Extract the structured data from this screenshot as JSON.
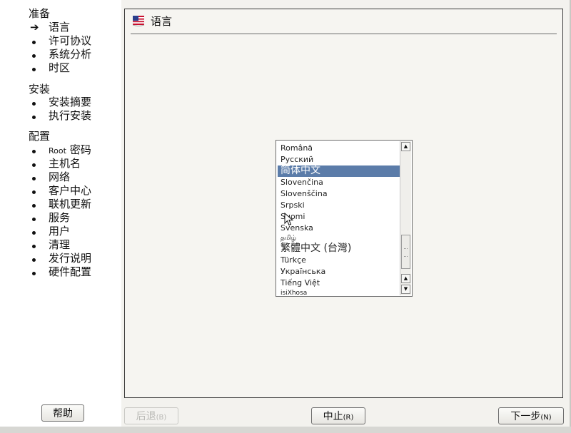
{
  "sidebar": {
    "sections": [
      {
        "title": "准备",
        "steps": [
          {
            "label": "语言",
            "marker": "arrow",
            "current": true
          },
          {
            "label": "许可协议",
            "marker": "bullet"
          },
          {
            "label": "系统分析",
            "marker": "bullet"
          },
          {
            "label": "时区",
            "marker": "bullet"
          }
        ]
      },
      {
        "title": "安装",
        "steps": [
          {
            "label": "安装摘要",
            "marker": "bullet"
          },
          {
            "label": "执行安装",
            "marker": "bullet"
          }
        ]
      },
      {
        "title": "配置",
        "steps": [
          {
            "label_small": "Root",
            "label": " 密码",
            "marker": "bullet"
          },
          {
            "label": "主机名",
            "marker": "bullet"
          },
          {
            "label": "网络",
            "marker": "bullet"
          },
          {
            "label": "客户中心",
            "marker": "bullet"
          },
          {
            "label": "联机更新",
            "marker": "bullet"
          },
          {
            "label": "服务",
            "marker": "bullet"
          },
          {
            "label": "用户",
            "marker": "bullet"
          },
          {
            "label": "清理",
            "marker": "bullet"
          },
          {
            "label": "发行说明",
            "marker": "bullet"
          },
          {
            "label": "硬件配置",
            "marker": "bullet"
          }
        ]
      }
    ]
  },
  "panel": {
    "title": "语言",
    "icon": "us-flag-icon"
  },
  "language_list": {
    "items": [
      {
        "label": "Română"
      },
      {
        "label": "Русский"
      },
      {
        "label": "简体中文",
        "selected": true,
        "size": "large"
      },
      {
        "label": "Slovenčina"
      },
      {
        "label": "Slovenščina"
      },
      {
        "label": "Srpski"
      },
      {
        "label": "Suomi"
      },
      {
        "label": "Svenska"
      },
      {
        "label": "தமிழ்",
        "size": "tiny"
      },
      {
        "label": "繁體中文 (台灣)",
        "size": "tall"
      },
      {
        "label": "Türkçe"
      },
      {
        "label": "Українська"
      },
      {
        "label": "Tiếng Việt"
      },
      {
        "label": "isiXhosa",
        "size": "tiny"
      }
    ],
    "scroll_position": 0.82
  },
  "buttons": {
    "help": "帮助",
    "back": "后退",
    "back_accel": "(B)",
    "abort": "中止",
    "abort_accel": "(R)",
    "next": "下一步",
    "next_accel": "(N)"
  },
  "colors": {
    "selection": "#5b7ca9",
    "panel_background": "#f6f5f1"
  }
}
